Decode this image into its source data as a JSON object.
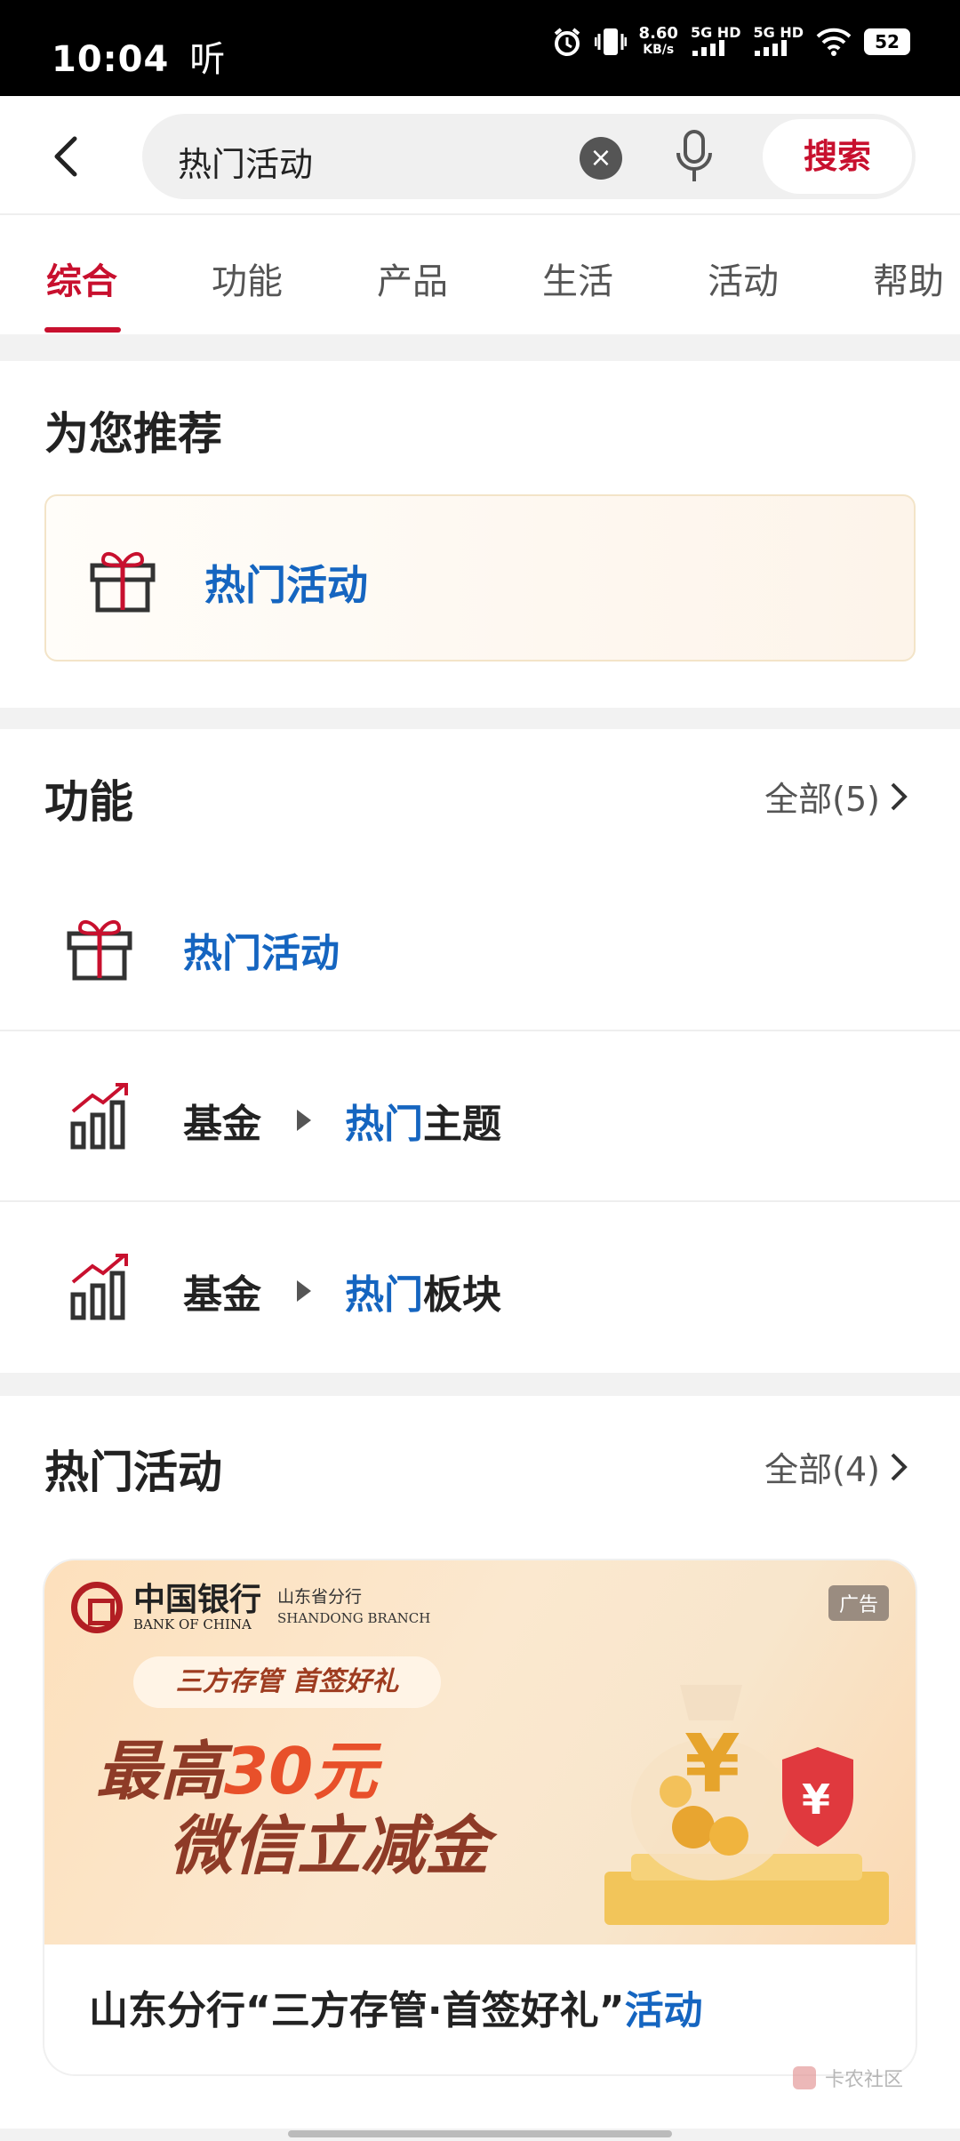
{
  "status_bar": {
    "time": "10:04",
    "listen_label": "听",
    "speed_value": "8.60",
    "speed_unit": "KB/s",
    "sim1": "5G HD",
    "sim2": "5G HD",
    "battery": "52"
  },
  "search": {
    "query": "热门活动",
    "clear_glyph": "×",
    "button_label": "搜索"
  },
  "tabs": [
    "综合",
    "功能",
    "产品",
    "生活",
    "活动",
    "帮助"
  ],
  "recommend": {
    "title": "为您推荐",
    "item_label": "热门活动"
  },
  "functions": {
    "title": "功能",
    "more_label": "全部(5)",
    "item1": "热门活动",
    "row2": {
      "left": "基金",
      "hl": "热门",
      "rest": "主题"
    },
    "row3": {
      "left": "基金",
      "hl": "热门",
      "rest": "板块"
    }
  },
  "activities": {
    "title": "热门活动",
    "more_label": "全部(4)",
    "banner": {
      "bank_name": "中国银行",
      "bank_en": "BANK OF CHINA",
      "branch_cn": "山东省分行",
      "branch_en": "SHANDONG BRANCH",
      "ad_badge": "广告",
      "pill": "三方存管 首签好礼",
      "line1_prefix": "最高",
      "line1_amount": "30元",
      "line2": "微信立减金"
    },
    "caption_main": "山东分行“三方存管·首签好礼”",
    "caption_hl": "活动"
  },
  "watermark": "卡农社区",
  "colors": {
    "brand_red": "#c8102e",
    "link_blue": "#1565c0"
  }
}
